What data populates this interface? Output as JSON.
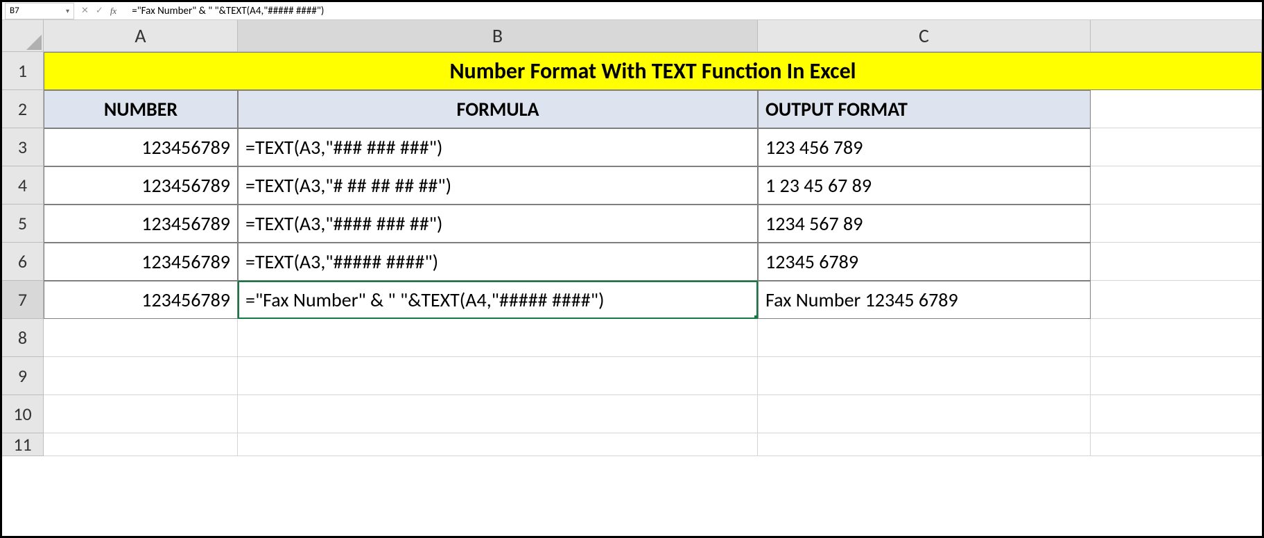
{
  "nameBox": "B7",
  "formulaBar": "=\"Fax Number\" & \" \"&TEXT(A4,\"##### ####\")",
  "fxLabel": "fx",
  "cancelIcon": "✕",
  "enterIcon": "✓",
  "colHeaders": [
    "A",
    "B",
    "C"
  ],
  "rowHeaders": [
    "1",
    "2",
    "3",
    "4",
    "5",
    "6",
    "7",
    "8",
    "9",
    "10",
    "11"
  ],
  "title": "Number Format With TEXT Function In Excel",
  "tableHeaders": {
    "a": "NUMBER",
    "b": "FORMULA",
    "c": "OUTPUT FORMAT"
  },
  "rows": [
    {
      "num": "123456789",
      "formula": "=TEXT(A3,\"### ### ###\")",
      "output": "123 456 789"
    },
    {
      "num": "123456789",
      "formula": "=TEXT(A3,\"# ## ## ## ##\")",
      "output": "1 23 45 67 89"
    },
    {
      "num": "123456789",
      "formula": "=TEXT(A3,\"#### ### ##\")",
      "output": "1234 567 89"
    },
    {
      "num": "123456789",
      "formula": "=TEXT(A3,\"##### ####\")",
      "output": "12345 6789"
    },
    {
      "num": "123456789",
      "formula": "=\"Fax Number\" & \" \"&TEXT(A4,\"##### ####\")",
      "output": "Fax Number 12345 6789"
    }
  ],
  "activeCell": {
    "row": 7,
    "col": "B"
  }
}
